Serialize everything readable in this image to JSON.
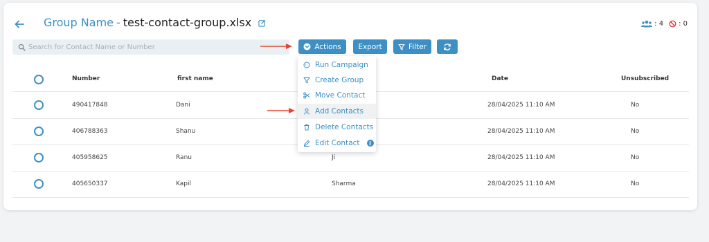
{
  "header": {
    "group_label": "Group Name",
    "separator": "-",
    "file_name": "test-contact-group.xlsx",
    "contacts_count": ": 4",
    "blocked_count": ": 0"
  },
  "search": {
    "placeholder": "Search for Contact Name or Number",
    "value": ""
  },
  "toolbar": {
    "actions_label": "Actions",
    "export_label": "Export",
    "filter_label": "Filter"
  },
  "actions_menu": {
    "items": [
      {
        "label": "Run Campaign",
        "icon": "campaign-icon"
      },
      {
        "label": "Create Group",
        "icon": "funnel-icon"
      },
      {
        "label": "Move Contact",
        "icon": "scissors-icon"
      },
      {
        "label": "Add Contacts",
        "icon": "user-icon"
      },
      {
        "label": "Delete Contacts",
        "icon": "trash-icon"
      },
      {
        "label": "Edit Contact",
        "icon": "pencil-icon"
      }
    ],
    "info_glyph": "i"
  },
  "table": {
    "columns": [
      "Number",
      "first name",
      "",
      "Date",
      "Unsubscribed"
    ],
    "rows": [
      {
        "number": "490417848",
        "first_name": "Dani",
        "last_name": "",
        "date": "28/04/2025 11:10 AM",
        "unsubscribed": "No"
      },
      {
        "number": "406788363",
        "first_name": "Shanu",
        "last_name": "",
        "date": "28/04/2025 11:10 AM",
        "unsubscribed": "No"
      },
      {
        "number": "405958625",
        "first_name": "Ranu",
        "last_name": "Ji",
        "date": "28/04/2025 11:10 AM",
        "unsubscribed": "No"
      },
      {
        "number": "405650337",
        "first_name": "Kapil",
        "last_name": "Sharma",
        "date": "28/04/2025 11:10 AM",
        "unsubscribed": "No"
      }
    ]
  },
  "colors": {
    "accent": "#3d8fc4",
    "annotation_arrow": "#e8452c",
    "blocked_icon": "#e03b3b"
  }
}
